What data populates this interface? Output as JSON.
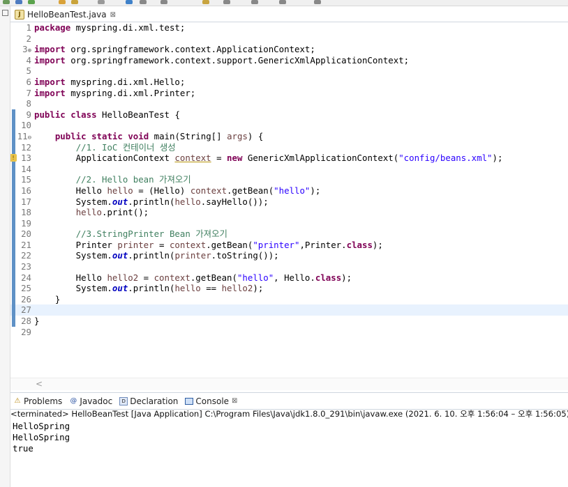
{
  "editor": {
    "tab_label": "HelloBeanTest.java",
    "tab_close": "⊠",
    "java_icon_letter": "J",
    "lines": [
      {
        "num": "1",
        "tokens": [
          {
            "t": "kw",
            "v": "package"
          },
          {
            "t": "",
            "v": " myspring.di.xml.test;"
          }
        ]
      },
      {
        "num": "2",
        "tokens": []
      },
      {
        "num": "3",
        "fold": "⊕",
        "tokens": [
          {
            "t": "kw",
            "v": "import"
          },
          {
            "t": "",
            "v": " org.springframework.context.ApplicationContext;"
          }
        ]
      },
      {
        "num": "4",
        "tokens": [
          {
            "t": "kw",
            "v": "import"
          },
          {
            "t": "",
            "v": " org.springframework.context.support.GenericXmlApplicationContext;"
          }
        ]
      },
      {
        "num": "5",
        "tokens": []
      },
      {
        "num": "6",
        "tokens": [
          {
            "t": "kw",
            "v": "import"
          },
          {
            "t": "",
            "v": " myspring.di.xml.Hello;"
          }
        ]
      },
      {
        "num": "7",
        "tokens": [
          {
            "t": "kw",
            "v": "import"
          },
          {
            "t": "",
            "v": " myspring.di.xml.Printer;"
          }
        ]
      },
      {
        "num": "8",
        "tokens": []
      },
      {
        "num": "9",
        "chg": true,
        "tokens": [
          {
            "t": "kw",
            "v": "public"
          },
          {
            "t": "",
            "v": " "
          },
          {
            "t": "kw",
            "v": "class"
          },
          {
            "t": "",
            "v": " HelloBeanTest {"
          }
        ]
      },
      {
        "num": "10",
        "chg": true,
        "tokens": []
      },
      {
        "num": "11",
        "fold": "⊖",
        "chg": true,
        "tokens": [
          {
            "t": "",
            "v": "    "
          },
          {
            "t": "kw",
            "v": "public"
          },
          {
            "t": "",
            "v": " "
          },
          {
            "t": "kw",
            "v": "static"
          },
          {
            "t": "",
            "v": " "
          },
          {
            "t": "kw",
            "v": "void"
          },
          {
            "t": "",
            "v": " main(String[] "
          },
          {
            "t": "lv",
            "v": "args"
          },
          {
            "t": "",
            "v": ") {"
          }
        ]
      },
      {
        "num": "12",
        "chg": true,
        "tokens": [
          {
            "t": "",
            "v": "        "
          },
          {
            "t": "cm",
            "v": "//1. IoC "
          },
          {
            "t": "cmko",
            "v": "컨테이너 생성"
          }
        ]
      },
      {
        "num": "13",
        "chg": true,
        "warn": true,
        "tokens": [
          {
            "t": "",
            "v": "        ApplicationContext "
          },
          {
            "t": "lvul",
            "v": "context"
          },
          {
            "t": "",
            "v": " = "
          },
          {
            "t": "kw",
            "v": "new"
          },
          {
            "t": "",
            "v": " GenericXmlApplicationContext("
          },
          {
            "t": "str",
            "v": "\"config/beans.xml\""
          },
          {
            "t": "",
            "v": ");"
          }
        ]
      },
      {
        "num": "14",
        "chg": true,
        "tokens": []
      },
      {
        "num": "15",
        "chg": true,
        "tokens": [
          {
            "t": "",
            "v": "        "
          },
          {
            "t": "cm",
            "v": "//2. Hello bean "
          },
          {
            "t": "cmko",
            "v": "가져오기"
          }
        ]
      },
      {
        "num": "16",
        "chg": true,
        "tokens": [
          {
            "t": "",
            "v": "        Hello "
          },
          {
            "t": "lv",
            "v": "hello"
          },
          {
            "t": "",
            "v": " = (Hello) "
          },
          {
            "t": "lv",
            "v": "context"
          },
          {
            "t": "",
            "v": ".getBean("
          },
          {
            "t": "str",
            "v": "\"hello\""
          },
          {
            "t": "",
            "v": ");"
          }
        ]
      },
      {
        "num": "17",
        "chg": true,
        "tokens": [
          {
            "t": "",
            "v": "        System."
          },
          {
            "t": "fld",
            "v": "out"
          },
          {
            "t": "",
            "v": ".println("
          },
          {
            "t": "lv",
            "v": "hello"
          },
          {
            "t": "",
            "v": ".sayHello());"
          }
        ]
      },
      {
        "num": "18",
        "chg": true,
        "tokens": [
          {
            "t": "",
            "v": "        "
          },
          {
            "t": "lv",
            "v": "hello"
          },
          {
            "t": "",
            "v": ".print();"
          }
        ]
      },
      {
        "num": "19",
        "chg": true,
        "tokens": []
      },
      {
        "num": "20",
        "chg": true,
        "tokens": [
          {
            "t": "",
            "v": "        "
          },
          {
            "t": "cm",
            "v": "//3.StringPrinter Bean "
          },
          {
            "t": "cmko",
            "v": "가져오기"
          }
        ]
      },
      {
        "num": "21",
        "chg": true,
        "tokens": [
          {
            "t": "",
            "v": "        Printer "
          },
          {
            "t": "lv",
            "v": "printer"
          },
          {
            "t": "",
            "v": " = "
          },
          {
            "t": "lv",
            "v": "context"
          },
          {
            "t": "",
            "v": ".getBean("
          },
          {
            "t": "str",
            "v": "\"printer\""
          },
          {
            "t": "",
            "v": ",Printer."
          },
          {
            "t": "kw",
            "v": "class"
          },
          {
            "t": "",
            "v": ");"
          }
        ]
      },
      {
        "num": "22",
        "chg": true,
        "tokens": [
          {
            "t": "",
            "v": "        System."
          },
          {
            "t": "fld",
            "v": "out"
          },
          {
            "t": "",
            "v": ".println("
          },
          {
            "t": "lv",
            "v": "printer"
          },
          {
            "t": "",
            "v": ".toString());"
          }
        ]
      },
      {
        "num": "23",
        "chg": true,
        "tokens": []
      },
      {
        "num": "24",
        "chg": true,
        "tokens": [
          {
            "t": "",
            "v": "        Hello "
          },
          {
            "t": "lv",
            "v": "hello2"
          },
          {
            "t": "",
            "v": " = "
          },
          {
            "t": "lv",
            "v": "context"
          },
          {
            "t": "",
            "v": ".getBean("
          },
          {
            "t": "str",
            "v": "\"hello\""
          },
          {
            "t": "",
            "v": ", Hello."
          },
          {
            "t": "kw",
            "v": "class"
          },
          {
            "t": "",
            "v": ");"
          }
        ]
      },
      {
        "num": "25",
        "chg": true,
        "tokens": [
          {
            "t": "",
            "v": "        System."
          },
          {
            "t": "fld",
            "v": "out"
          },
          {
            "t": "",
            "v": ".println("
          },
          {
            "t": "lv",
            "v": "hello"
          },
          {
            "t": "",
            "v": " == "
          },
          {
            "t": "lv",
            "v": "hello2"
          },
          {
            "t": "",
            "v": ");"
          }
        ]
      },
      {
        "num": "26",
        "chg": true,
        "tokens": [
          {
            "t": "",
            "v": "    }"
          }
        ]
      },
      {
        "num": "27",
        "chg": true,
        "current": true,
        "tokens": []
      },
      {
        "num": "28",
        "chg": true,
        "tokens": [
          {
            "t": "",
            "v": "}"
          }
        ]
      },
      {
        "num": "29",
        "tokens": []
      }
    ],
    "scroll_arrow": "<"
  },
  "console": {
    "tabs": [
      {
        "label": "Problems",
        "icon": "problems-icon",
        "glyph": "⚠"
      },
      {
        "label": "Javadoc",
        "icon": "javadoc-icon",
        "glyph": "@"
      },
      {
        "label": "Declaration",
        "icon": "declaration-icon",
        "glyph": "D"
      },
      {
        "label": "Console",
        "icon": "console-icon",
        "glyph": "",
        "close": "⊠"
      }
    ],
    "status": "<terminated> HelloBeanTest [Java Application] C:\\Program Files\\Java\\jdk1.8.0_291\\bin\\javaw.exe  (2021. 6. 10. 오후 1:56:04 – 오후 1:56:05)",
    "output": [
      "HelloSpring",
      "HelloSpring",
      "true"
    ]
  },
  "colors": {
    "keyword": "#7f0055",
    "string": "#2a00ff",
    "comment": "#3f7f5f",
    "field": "#0000c0",
    "local": "#6a3e3e",
    "current_line": "#e8f2fe",
    "change_bar": "#5f91c6"
  }
}
